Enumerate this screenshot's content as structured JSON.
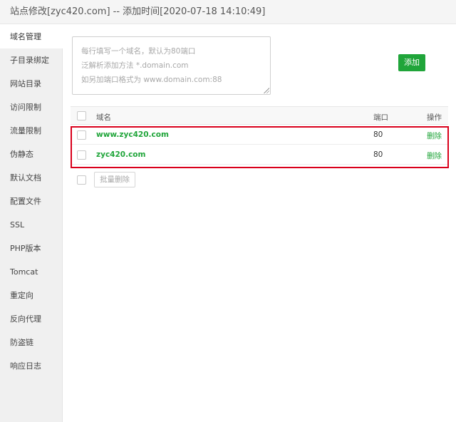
{
  "title": "站点修改[zyc420.com] -- 添加时间[2020-07-18 14:10:49]",
  "sidebar": {
    "items": [
      {
        "label": "域名管理"
      },
      {
        "label": "子目录绑定"
      },
      {
        "label": "网站目录"
      },
      {
        "label": "访问限制"
      },
      {
        "label": "流量限制"
      },
      {
        "label": "伪静态"
      },
      {
        "label": "默认文档"
      },
      {
        "label": "配置文件"
      },
      {
        "label": "SSL"
      },
      {
        "label": "PHP版本"
      },
      {
        "label": "Tomcat"
      },
      {
        "label": "重定向"
      },
      {
        "label": "反向代理"
      },
      {
        "label": "防盗链"
      },
      {
        "label": "响应日志"
      }
    ]
  },
  "domain_input": {
    "placeholder_lines": [
      "每行填写一个域名，默认为80端口",
      "泛解析添加方法 *.domain.com",
      "如另加端口格式为 www.domain.com:88"
    ]
  },
  "add_button": "添加",
  "table": {
    "headers": {
      "domain": "域名",
      "port": "端口",
      "action": "操作"
    },
    "rows": [
      {
        "domain": "www.zyc420.com",
        "port": "80",
        "action": "删除"
      },
      {
        "domain": "zyc420.com",
        "port": "80",
        "action": "删除"
      }
    ]
  },
  "batch_delete_button": "批量删除",
  "colors": {
    "accent": "#20a53a",
    "highlight": "#d9001b"
  }
}
